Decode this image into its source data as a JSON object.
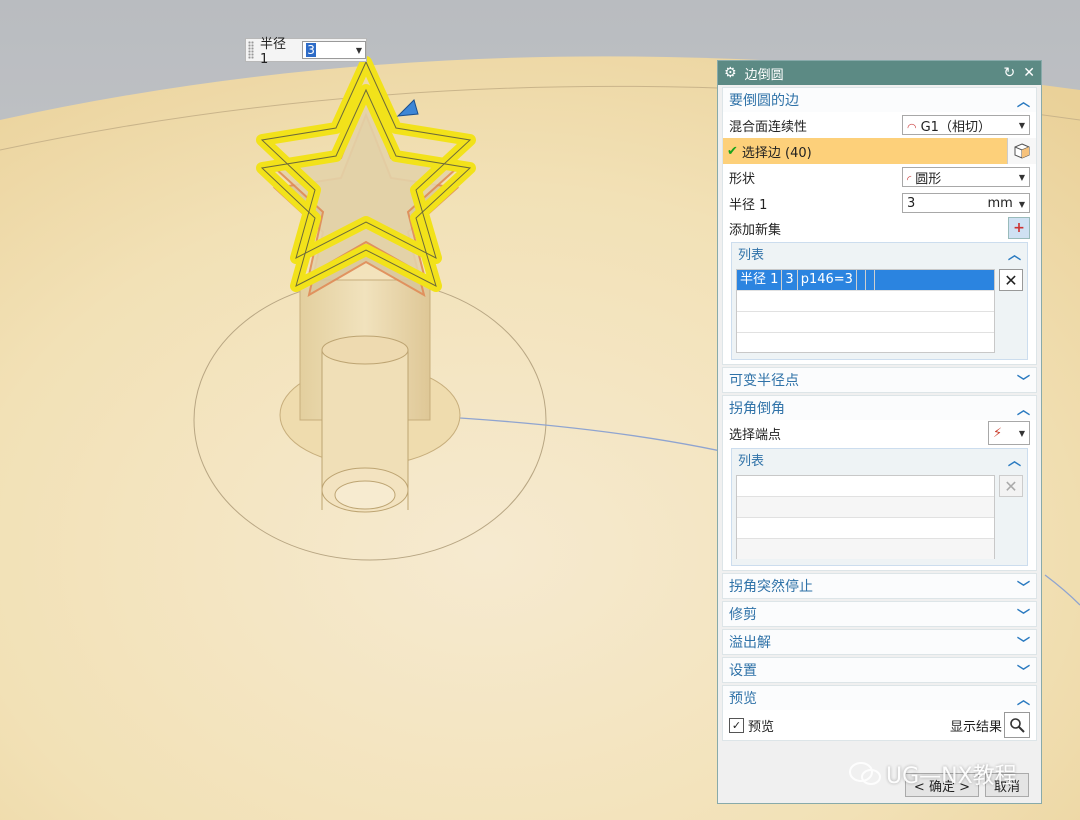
{
  "radius_box": {
    "label": "半径 1",
    "value": "3"
  },
  "dialog": {
    "title": "边倒圆",
    "sections": {
      "edges": {
        "title": "要倒圆的边",
        "continuity_label": "混合面连续性",
        "continuity_value": "G1（相切）",
        "select_edge": "选择边 (40)",
        "shape_label": "形状",
        "shape_value": "圆形",
        "radius_label": "半径 1",
        "radius_value": "3",
        "radius_unit": "mm",
        "add_set_label": "添加新集",
        "list_title": "列表",
        "list_rows": [
          {
            "name": "半径 1",
            "value": "3",
            "expr": "p146=3"
          }
        ]
      },
      "variable_radius": {
        "title": "可变半径点"
      },
      "corner_setback": {
        "title": "拐角倒角",
        "select_end_label": "选择端点",
        "list_title": "列表"
      },
      "corner_stop": {
        "title": "拐角突然停止"
      },
      "trim": {
        "title": "修剪"
      },
      "overflow": {
        "title": "溢出解"
      },
      "settings": {
        "title": "设置"
      },
      "preview": {
        "title": "预览",
        "preview_label": "预览",
        "show_result_label": "显示结果"
      }
    },
    "ok_label": "< 确定 >",
    "cancel_label": "取消"
  },
  "watermark": "UG—NX教程",
  "colors": {
    "title_bar": "#5c8a84",
    "section_text": "#2f72a8",
    "selected_row": "#fdd07a",
    "list_selection": "#2b84e0",
    "model_fill": "#f3dfa8",
    "fillet_highlight": "#f2e21a"
  }
}
